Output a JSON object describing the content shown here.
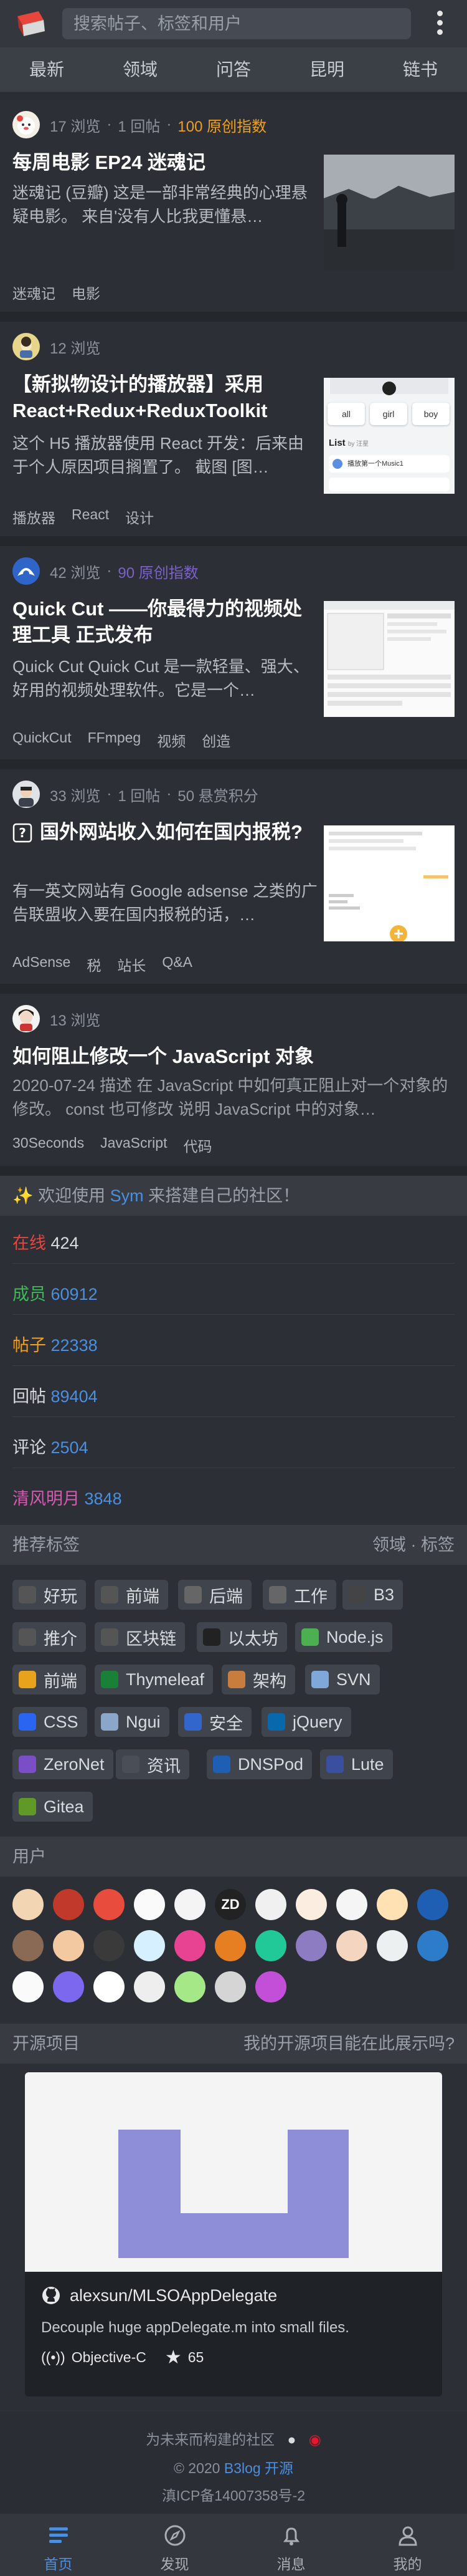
{
  "header": {
    "search_placeholder": "搜索帖子、标签和用户",
    "tabs": [
      "最新",
      "领域",
      "问答",
      "昆明",
      "链书"
    ]
  },
  "articles": [
    {
      "views": "17 浏览",
      "replies": "1 回帖",
      "points": "100 原创指数",
      "title": "每周电影 EP24 迷魂记",
      "excerpt": "迷魂记 (豆瓣) 这是一部非常经典的心理悬疑电影。 来自'没有人比我更懂悬…",
      "tags": [
        "迷魂记",
        "电影"
      ]
    },
    {
      "views": "12 浏览",
      "title": "【新拟物设计的播放器】采用React+Redux+ReduxToolkit",
      "excerpt": "这个 H5 播放器使用 React 开发：后来由于个人原因项目搁置了。 截图 [图…",
      "tags": [
        "播放器",
        "React",
        "设计"
      ],
      "thumb": {
        "labels": [
          "all",
          "girl",
          "boy"
        ],
        "list_title": "List",
        "list_sub": "by 汪星",
        "item": "播放第一个Music1"
      }
    },
    {
      "views": "42 浏览",
      "points": "90 原创指数",
      "title": "Quick Cut ——你最得力的视频处理工具 正式发布",
      "excerpt": "Quick Cut Quick Cut 是一款轻量、强大、好用的视频处理软件。它是一个…",
      "tags": [
        "QuickCut",
        "FFmpeg",
        "视频",
        "创造"
      ]
    },
    {
      "views": "33 浏览",
      "replies": "1 回帖",
      "points": "50 悬赏积分",
      "title": "国外网站收入如何在国内报税?",
      "excerpt": "有一英文网站有 Google adsense 之类的广告联盟收入要在国内报税的话，…",
      "tags": [
        "AdSense",
        "税",
        "站长",
        "Q&A"
      ]
    },
    {
      "views": "13 浏览",
      "title": "如何阻止修改一个 JavaScript 对象",
      "excerpt": "2020-07-24 描述 在 JavaScript 中如何真正阻止对一个对象的修改。 const 也可修改 说明 JavaScript 中的对象…",
      "tags": [
        "30Seconds",
        "JavaScript",
        "代码"
      ]
    }
  ],
  "welcome": {
    "prefix": "✨ 欢迎使用 ",
    "link": "Sym",
    "suffix": " 来搭建自己的社区！"
  },
  "stats": [
    {
      "label": "在线",
      "value": "424",
      "color": "#e8453c"
    },
    {
      "label": "成员",
      "value": "60912",
      "color": "#3fb95a"
    },
    {
      "label": "帖子",
      "value": "22338",
      "color": "#f0a020"
    },
    {
      "label": "回帖",
      "value": "89404",
      "color": "#d9dcdf"
    },
    {
      "label": "评论",
      "value": "2504",
      "color": "#d9dcdf"
    },
    {
      "label": "清风明月",
      "value": "3848",
      "color": "#d65ab0"
    }
  ],
  "tag_section": {
    "title": "推荐标签",
    "links": [
      "领域",
      "标签"
    ],
    "tags": [
      "好玩",
      "前端",
      "后端",
      "工作",
      "B3",
      "推介",
      "区块链",
      "以太坊",
      "Node.js",
      "前端",
      "Thymeleaf",
      "架构",
      "SVN",
      "CSS",
      "Ngui",
      "安全",
      "jQuery",
      "ZeroNet",
      "资讯",
      "DNSPod",
      "Lute",
      "Gitea"
    ]
  },
  "users": {
    "title": "用户",
    "avatar_texts": [
      "ZD"
    ]
  },
  "opensource": {
    "title": "开源项目",
    "link": "我的开源项目能在此展示吗?",
    "repo_name": "alexsun/MLSOAppDelegate",
    "repo_desc": "Decouple huge appDelegate.m into small files.",
    "language": "Objective-C",
    "stars": "65"
  },
  "footer": {
    "line1": "为未来而构建的社区",
    "copyright": "© 2020 ",
    "brand": "B3log 开源",
    "icp": "滇ICP备14007358号-2"
  },
  "bottom_nav": [
    "首页",
    "发现",
    "消息",
    "我的"
  ],
  "colors": {
    "accent": "#4a8fe0",
    "background": "#2a2d33"
  }
}
